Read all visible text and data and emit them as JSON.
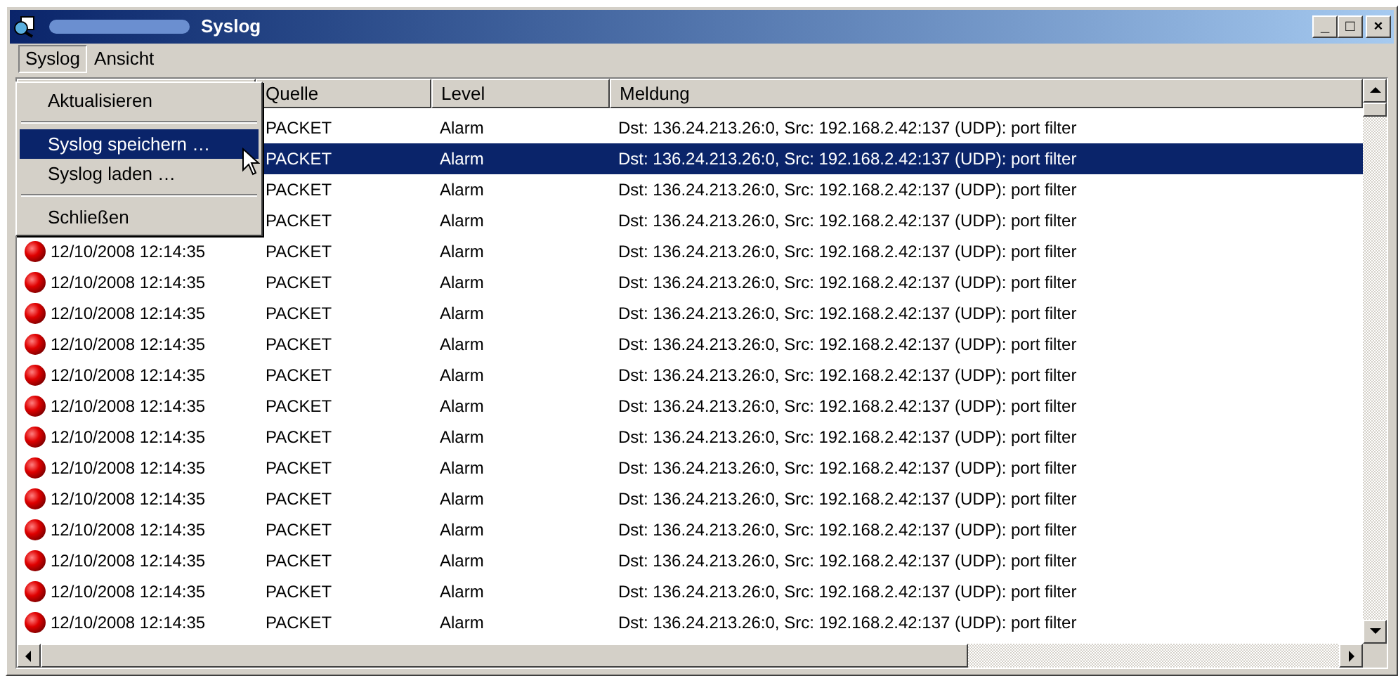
{
  "window": {
    "title": "Syslog",
    "controls": [
      "_",
      "□",
      "×"
    ]
  },
  "menubar": [
    {
      "label": "Syslog",
      "selected": true
    },
    {
      "label": "Ansicht",
      "selected": false
    }
  ],
  "menu": [
    {
      "kind": "item",
      "label": "Aktualisieren",
      "selected": false
    },
    {
      "kind": "separator"
    },
    {
      "kind": "item",
      "label": "Syslog speichern …",
      "selected": true
    },
    {
      "kind": "item",
      "label": "Syslog laden …",
      "selected": false
    },
    {
      "kind": "separator"
    },
    {
      "kind": "item",
      "label": "Schließen",
      "selected": false
    }
  ],
  "table": {
    "columns": [
      "",
      "Quelle",
      "Level",
      "Meldung"
    ],
    "rows": [
      {
        "source": "PACKET",
        "level": "Alarm",
        "message": "Dst: 136.24.213.26:0, Src: 192.168.2.42:137 (UDP): port filter",
        "selected": false
      },
      {
        "source": "PACKET",
        "level": "Alarm",
        "message": "Dst: 136.24.213.26:0, Src: 192.168.2.42:137 (UDP): port filter",
        "selected": true
      },
      {
        "source": "PACKET",
        "level": "Alarm",
        "message": "Dst: 136.24.213.26:0, Src: 192.168.2.42:137 (UDP): port filter",
        "selected": false
      },
      {
        "source": "PACKET",
        "level": "Alarm",
        "message": "Dst: 136.24.213.26:0, Src: 192.168.2.42:137 (UDP): port filter",
        "selected": false
      },
      {
        "time": "12/10/2008 12:14:35",
        "source": "PACKET",
        "level": "Alarm",
        "message": "Dst: 136.24.213.26:0, Src: 192.168.2.42:137 (UDP): port filter",
        "selected": false
      },
      {
        "time": "12/10/2008 12:14:35",
        "source": "PACKET",
        "level": "Alarm",
        "message": "Dst: 136.24.213.26:0, Src: 192.168.2.42:137 (UDP): port filter",
        "selected": false
      },
      {
        "time": "12/10/2008 12:14:35",
        "source": "PACKET",
        "level": "Alarm",
        "message": "Dst: 136.24.213.26:0, Src: 192.168.2.42:137 (UDP): port filter",
        "selected": false
      },
      {
        "time": "12/10/2008 12:14:35",
        "source": "PACKET",
        "level": "Alarm",
        "message": "Dst: 136.24.213.26:0, Src: 192.168.2.42:137 (UDP): port filter",
        "selected": false
      },
      {
        "time": "12/10/2008 12:14:35",
        "source": "PACKET",
        "level": "Alarm",
        "message": "Dst: 136.24.213.26:0, Src: 192.168.2.42:137 (UDP): port filter",
        "selected": false
      },
      {
        "time": "12/10/2008 12:14:35",
        "source": "PACKET",
        "level": "Alarm",
        "message": "Dst: 136.24.213.26:0, Src: 192.168.2.42:137 (UDP): port filter",
        "selected": false
      },
      {
        "time": "12/10/2008 12:14:35",
        "source": "PACKET",
        "level": "Alarm",
        "message": "Dst: 136.24.213.26:0, Src: 192.168.2.42:137 (UDP): port filter",
        "selected": false
      },
      {
        "time": "12/10/2008 12:14:35",
        "source": "PACKET",
        "level": "Alarm",
        "message": "Dst: 136.24.213.26:0, Src: 192.168.2.42:137 (UDP): port filter",
        "selected": false
      },
      {
        "time": "12/10/2008 12:14:35",
        "source": "PACKET",
        "level": "Alarm",
        "message": "Dst: 136.24.213.26:0, Src: 192.168.2.42:137 (UDP): port filter",
        "selected": false
      },
      {
        "time": "12/10/2008 12:14:35",
        "source": "PACKET",
        "level": "Alarm",
        "message": "Dst: 136.24.213.26:0, Src: 192.168.2.42:137 (UDP): port filter",
        "selected": false
      },
      {
        "time": "12/10/2008 12:14:35",
        "source": "PACKET",
        "level": "Alarm",
        "message": "Dst: 136.24.213.26:0, Src: 192.168.2.42:137 (UDP): port filter",
        "selected": false
      },
      {
        "time": "12/10/2008 12:14:35",
        "source": "PACKET",
        "level": "Alarm",
        "message": "Dst: 136.24.213.26:0, Src: 192.168.2.42:137 (UDP): port filter",
        "selected": false
      },
      {
        "time": "12/10/2008 12:14:35",
        "source": "PACKET",
        "level": "Alarm",
        "message": "Dst: 136.24.213.26:0, Src: 192.168.2.42:137 (UDP): port filter",
        "selected": false
      }
    ]
  }
}
